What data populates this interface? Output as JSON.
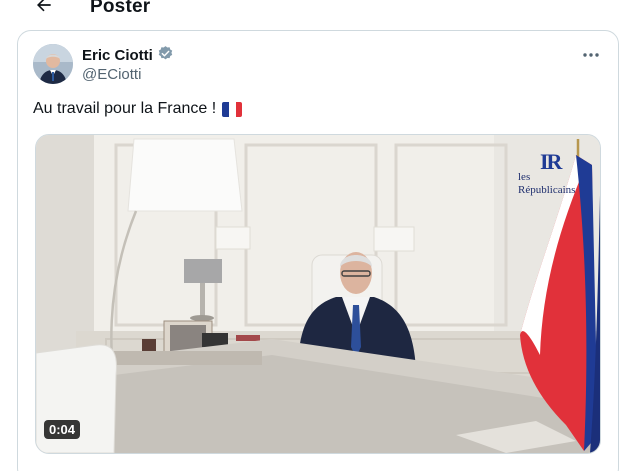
{
  "header": {
    "title": "Poster",
    "back_icon": "arrow-left-icon"
  },
  "tweet": {
    "author_name": "Eric Ciotti",
    "author_handle": "@ECiotti",
    "verified_icon": "verified-badge-icon",
    "more_icon": "more-horizontal-icon",
    "text": "Au travail pour la France !",
    "flag_icon": "flag-france-icon"
  },
  "media": {
    "type": "video",
    "duration": "0:04",
    "logo_line1": "les",
    "logo_line2": "Républicains",
    "logo_mark": "IR"
  },
  "colors": {
    "text": "#0f1419",
    "secondary_text": "#536471",
    "border": "#cfd9de",
    "verified_badge": "#829aab",
    "flag_blue": "#1f3b95",
    "flag_white": "#ffffff",
    "flag_red": "#e1313a"
  }
}
